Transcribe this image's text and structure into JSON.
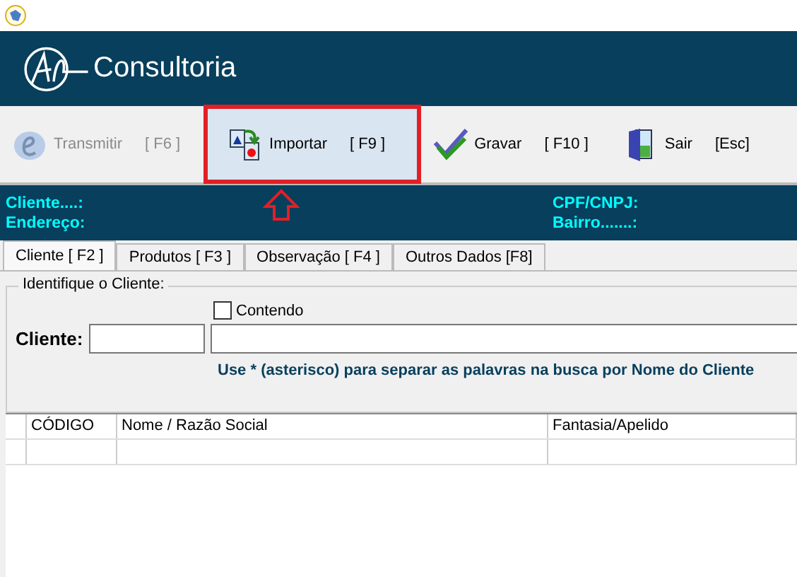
{
  "header": {
    "brand": "Consultoria"
  },
  "toolbar": [
    {
      "label": "Transmitir",
      "shortcut": "[ F6 ]",
      "kind": "nfe",
      "disabled": true,
      "highlighted": false
    },
    {
      "label": "Importar",
      "shortcut": "[ F9 ]",
      "kind": "import",
      "disabled": false,
      "highlighted": true
    },
    {
      "label": "Gravar",
      "shortcut": "[ F10 ]",
      "kind": "save",
      "disabled": false,
      "highlighted": false
    },
    {
      "label": "Sair",
      "shortcut": "[Esc]",
      "kind": "exit",
      "disabled": false,
      "highlighted": false
    }
  ],
  "info": {
    "left": [
      "Cliente....:",
      "Endereço:"
    ],
    "right": [
      "CPF/CNPJ:",
      "Bairro.......:"
    ]
  },
  "tabs": [
    {
      "label": "Cliente [ F2 ]",
      "selected": true
    },
    {
      "label": "Produtos [ F3 ]",
      "selected": false
    },
    {
      "label": "Observação [ F4 ]",
      "selected": false
    },
    {
      "label": "Outros Dados [F8]",
      "selected": false
    }
  ],
  "group": {
    "title": "Identifique o Cliente:",
    "contains": {
      "label": "Contendo",
      "checked": false
    },
    "field_label": "Cliente:",
    "hint": "Use * (asterisco) para separar as palavras na busca por Nome do Cliente"
  },
  "table": {
    "columns": [
      "CÓDIGO",
      "Nome / Razão Social",
      "Fantasia/Apelido"
    ]
  }
}
